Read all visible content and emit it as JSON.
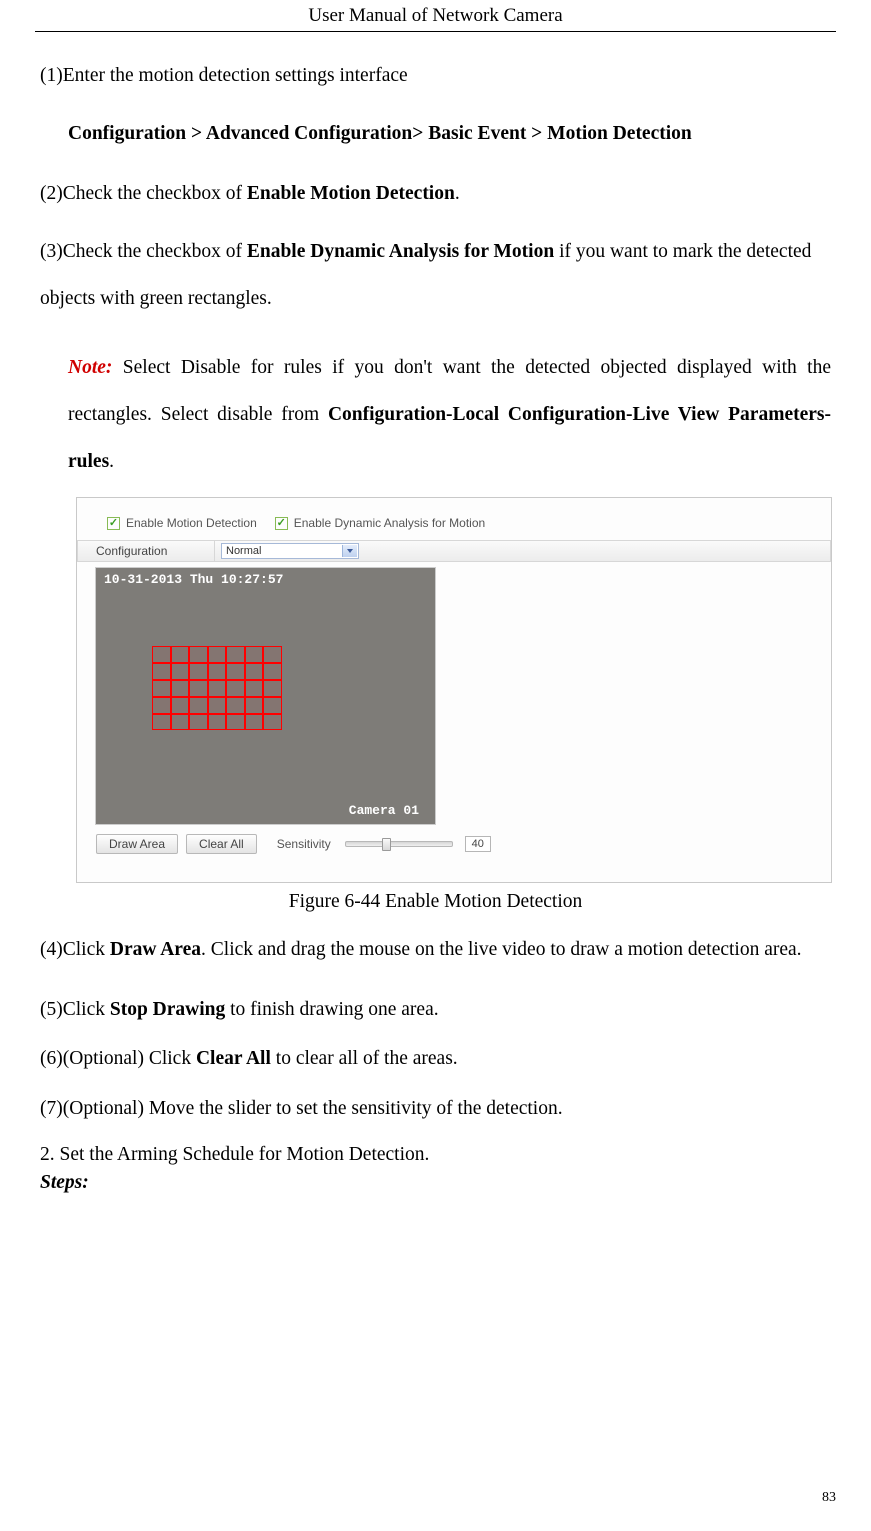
{
  "header": {
    "title": "User Manual of Network Camera"
  },
  "steps": {
    "s1_a": "(1)Enter the motion detection settings interface",
    "s1_b": "Configuration > Advanced Configuration> Basic Event > Motion Detection",
    "s2_a": "(2)Check the checkbox of ",
    "s2_b": "Enable Motion Detection",
    "s2_c": ".",
    "s3_a": "(3)Check the checkbox of ",
    "s3_b": "Enable Dynamic Analysis for Motion",
    "s3_c": " if you want to mark the detected objects with green rectangles.",
    "note_label": "Note:",
    "note_a": " Select Disable for rules if you don't want the detected objected displayed with the rectangles. Select disable from ",
    "note_b": "Configuration-Local Configuration-Live View Parameters-rules",
    "note_c": ".",
    "caption": "Figure 6-44 Enable Motion Detection",
    "s4_a": "(4)Click ",
    "s4_b": "Draw Area",
    "s4_c": ". Click and drag the mouse on the live video to draw a motion detection area.",
    "s5_a": "(5)Click ",
    "s5_b": "Stop Drawing",
    "s5_c": " to finish drawing one area.",
    "s6_a": "(6)(Optional) Click ",
    "s6_b": "Clear All",
    "s6_c": " to clear all of the areas.",
    "s7": "(7)(Optional) Move the slider to set the sensitivity of the detection.",
    "section2": "2.    Set the Arming Schedule for Motion Detection.",
    "steps_hdr": "Steps:"
  },
  "figure": {
    "chk1": "Enable Motion Detection",
    "chk2": "Enable Dynamic Analysis for Motion",
    "config_label": "Configuration",
    "config_value": "Normal",
    "timestamp": "10-31-2013 Thu 10:27:57",
    "camera": "Camera 01",
    "btn_draw": "Draw Area",
    "btn_clear": "Clear All",
    "sens_label": "Sensitivity",
    "sens_value": "40"
  },
  "pagenum": "83"
}
